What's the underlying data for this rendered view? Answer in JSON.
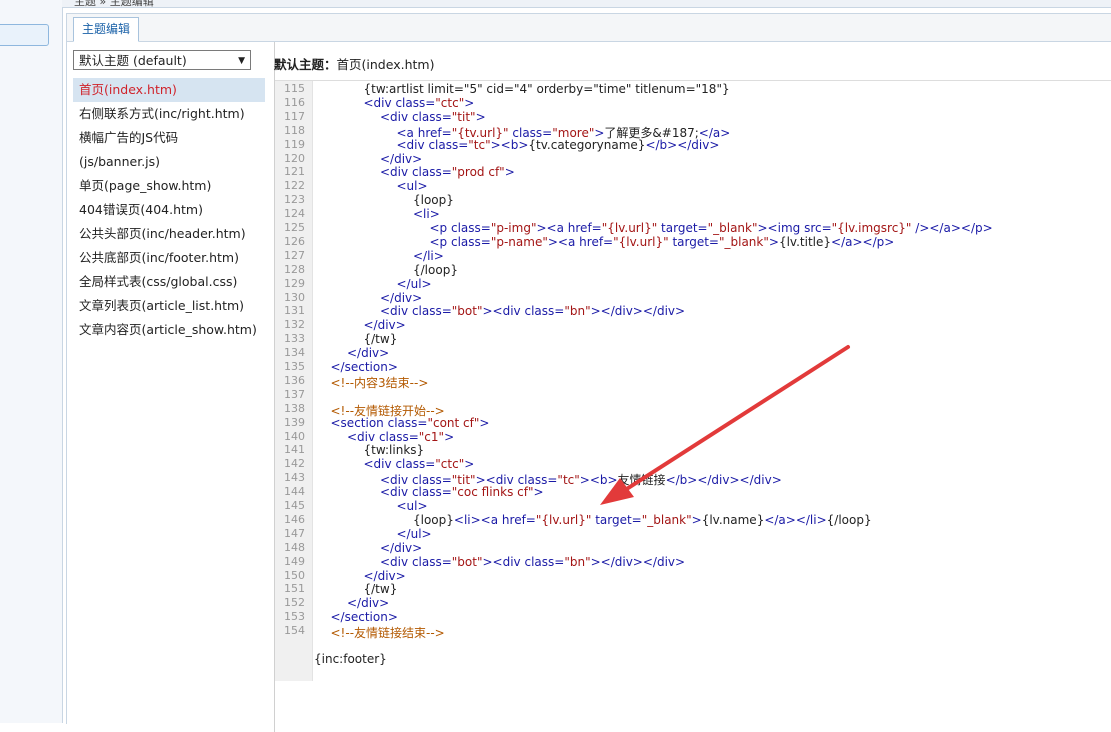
{
  "breadcrumb": "主题 » 主题编辑",
  "tab_label": "主题编辑",
  "theme_select": {
    "value": "默认主题 (default)"
  },
  "files": [
    {
      "label": "首页(index.htm)",
      "active": true
    },
    {
      "label": "右侧联系方式(inc/right.htm)"
    },
    {
      "label": "横幅广告的JS代码"
    },
    {
      "label": "(js/banner.js)"
    },
    {
      "label": "单页(page_show.htm)"
    },
    {
      "label": "404错误页(404.htm)"
    },
    {
      "label": "公共头部页(inc/header.htm)"
    },
    {
      "label": "公共底部页(inc/footer.htm)"
    },
    {
      "label": "全局样式表(css/global.css)"
    },
    {
      "label": "文章列表页(article_list.htm)"
    },
    {
      "label": "文章内容页(article_show.htm)"
    }
  ],
  "editor_title": {
    "label": "默认主题：",
    "file": "首页(index.htm)"
  },
  "code_lines": [
    {
      "n": "115",
      "indent": 3,
      "html": "{tw:artlist limit=\"5\" cid=\"4\" orderby=\"time\" titlenum=\"18\"}"
    },
    {
      "n": "116",
      "indent": 3,
      "html": "<span class='t'>&lt;div</span> <span class='a'>class=</span><span class='v'>\"ctc\"</span><span class='t'>&gt;</span>"
    },
    {
      "n": "117",
      "indent": 4,
      "html": "<span class='t'>&lt;div</span> <span class='a'>class=</span><span class='v'>\"tit\"</span><span class='t'>&gt;</span>"
    },
    {
      "n": "118",
      "indent": 5,
      "html": "<span class='t'>&lt;a</span> <span class='a'>href=</span><span class='v'>\"{tv.url}\"</span> <span class='a'>class=</span><span class='v'>\"more\"</span><span class='t'>&gt;</span>了解更多&amp;#187;<span class='t'>&lt;/a&gt;</span>"
    },
    {
      "n": "119",
      "indent": 5,
      "html": "<span class='t'>&lt;div</span> <span class='a'>class=</span><span class='v'>\"tc\"</span><span class='t'>&gt;&lt;b&gt;</span>{tv.categoryname}<span class='t'>&lt;/b&gt;&lt;/div&gt;</span>"
    },
    {
      "n": "120",
      "indent": 4,
      "html": "<span class='t'>&lt;/div&gt;</span>"
    },
    {
      "n": "121",
      "indent": 4,
      "html": "<span class='t'>&lt;div</span> <span class='a'>class=</span><span class='v'>\"prod cf\"</span><span class='t'>&gt;</span>"
    },
    {
      "n": "122",
      "indent": 5,
      "html": "<span class='t'>&lt;ul&gt;</span>"
    },
    {
      "n": "123",
      "indent": 6,
      "html": "{loop}"
    },
    {
      "n": "124",
      "indent": 6,
      "html": "<span class='t'>&lt;li&gt;</span>"
    },
    {
      "n": "125",
      "indent": 7,
      "html": "<span class='t'>&lt;p</span> <span class='a'>class=</span><span class='v'>\"p-img\"</span><span class='t'>&gt;&lt;a</span> <span class='a'>href=</span><span class='v'>\"{lv.url}\"</span> <span class='a'>target=</span><span class='v'>\"_blank\"</span><span class='t'>&gt;&lt;img</span> <span class='a'>src=</span><span class='v'>\"{lv.imgsrc}\"</span> <span class='t'>/&gt;&lt;/a&gt;&lt;/p&gt;</span>"
    },
    {
      "n": "126",
      "indent": 7,
      "html": "<span class='t'>&lt;p</span> <span class='a'>class=</span><span class='v'>\"p-name\"</span><span class='t'>&gt;&lt;a</span> <span class='a'>href=</span><span class='v'>\"{lv.url}\"</span> <span class='a'>target=</span><span class='v'>\"_blank\"</span><span class='t'>&gt;</span>{lv.title}<span class='t'>&lt;/a&gt;&lt;/p&gt;</span>"
    },
    {
      "n": "127",
      "indent": 6,
      "html": "<span class='t'>&lt;/li&gt;</span>"
    },
    {
      "n": "128",
      "indent": 6,
      "html": "{/loop}"
    },
    {
      "n": "129",
      "indent": 5,
      "html": "<span class='t'>&lt;/ul&gt;</span>"
    },
    {
      "n": "130",
      "indent": 4,
      "html": "<span class='t'>&lt;/div&gt;</span>"
    },
    {
      "n": "131",
      "indent": 4,
      "html": "<span class='t'>&lt;div</span> <span class='a'>class=</span><span class='v'>\"bot\"</span><span class='t'>&gt;&lt;div</span> <span class='a'>class=</span><span class='v'>\"bn\"</span><span class='t'>&gt;&lt;/div&gt;&lt;/div&gt;</span>"
    },
    {
      "n": "132",
      "indent": 3,
      "html": "<span class='t'>&lt;/div&gt;</span>"
    },
    {
      "n": "133",
      "indent": 3,
      "html": "{/tw}"
    },
    {
      "n": "134",
      "indent": 2,
      "html": "<span class='t'>&lt;/div&gt;</span>"
    },
    {
      "n": "135",
      "indent": 1,
      "html": "<span class='t'>&lt;/section&gt;</span>"
    },
    {
      "n": "136",
      "indent": 1,
      "html": "<span class='c'>&lt;!--内容3结束--&gt;</span>"
    },
    {
      "n": "137",
      "indent": 0,
      "html": ""
    },
    {
      "n": "138",
      "indent": 1,
      "html": "<span class='c'>&lt;!--友情链接开始--&gt;</span>"
    },
    {
      "n": "139",
      "indent": 1,
      "html": "<span class='t'>&lt;section</span> <span class='a'>class=</span><span class='v'>\"cont cf\"</span><span class='t'>&gt;</span>"
    },
    {
      "n": "140",
      "indent": 2,
      "html": "<span class='t'>&lt;div</span> <span class='a'>class=</span><span class='v'>\"c1\"</span><span class='t'>&gt;</span>"
    },
    {
      "n": "141",
      "indent": 3,
      "html": "{tw:links}"
    },
    {
      "n": "142",
      "indent": 3,
      "html": "<span class='t'>&lt;div</span> <span class='a'>class=</span><span class='v'>\"ctc\"</span><span class='t'>&gt;</span>"
    },
    {
      "n": "143",
      "indent": 4,
      "html": "<span class='t'>&lt;div</span> <span class='a'>class=</span><span class='v'>\"tit\"</span><span class='t'>&gt;&lt;div</span> <span class='a'>class=</span><span class='v'>\"tc\"</span><span class='t'>&gt;&lt;b&gt;</span>友情链接<span class='t'>&lt;/b&gt;&lt;/div&gt;&lt;/div&gt;</span>"
    },
    {
      "n": "144",
      "indent": 4,
      "html": "<span class='t'>&lt;div</span> <span class='a'>class=</span><span class='v'>\"coc flinks cf\"</span><span class='t'>&gt;</span>"
    },
    {
      "n": "145",
      "indent": 5,
      "html": "<span class='t'>&lt;ul&gt;</span>"
    },
    {
      "n": "146",
      "indent": 6,
      "html": "{loop}<span class='t'>&lt;li&gt;&lt;a</span> <span class='a'>href=</span><span class='v'>\"{lv.url}\"</span> <span class='a'>target=</span><span class='v'>\"_blank\"</span><span class='t'>&gt;</span>{lv.name}<span class='t'>&lt;/a&gt;&lt;/li&gt;</span>{/loop}"
    },
    {
      "n": "147",
      "indent": 5,
      "html": "<span class='t'>&lt;/ul&gt;</span>"
    },
    {
      "n": "148",
      "indent": 4,
      "html": "<span class='t'>&lt;/div&gt;</span>"
    },
    {
      "n": "149",
      "indent": 4,
      "html": "<span class='t'>&lt;div</span> <span class='a'>class=</span><span class='v'>\"bot\"</span><span class='t'>&gt;&lt;div</span> <span class='a'>class=</span><span class='v'>\"bn\"</span><span class='t'>&gt;&lt;/div&gt;&lt;/div&gt;</span>"
    },
    {
      "n": "150",
      "indent": 3,
      "html": "<span class='t'>&lt;/div&gt;</span>"
    },
    {
      "n": "151",
      "indent": 3,
      "html": "{/tw}"
    },
    {
      "n": "152",
      "indent": 2,
      "html": "<span class='t'>&lt;/div&gt;</span>"
    },
    {
      "n": "153",
      "indent": 1,
      "html": "<span class='t'>&lt;/section&gt;</span>"
    },
    {
      "n": "154",
      "indent": 1,
      "html": "<span class='c'>&lt;!--友情链接结束--&gt;</span>"
    },
    {
      "n": "",
      "indent": 0,
      "html": ""
    },
    {
      "n": "",
      "indent": 0,
      "html": "{inc:footer}"
    }
  ],
  "colors": {
    "arrow": "#e23a3a",
    "active_file": "#d0232b"
  }
}
